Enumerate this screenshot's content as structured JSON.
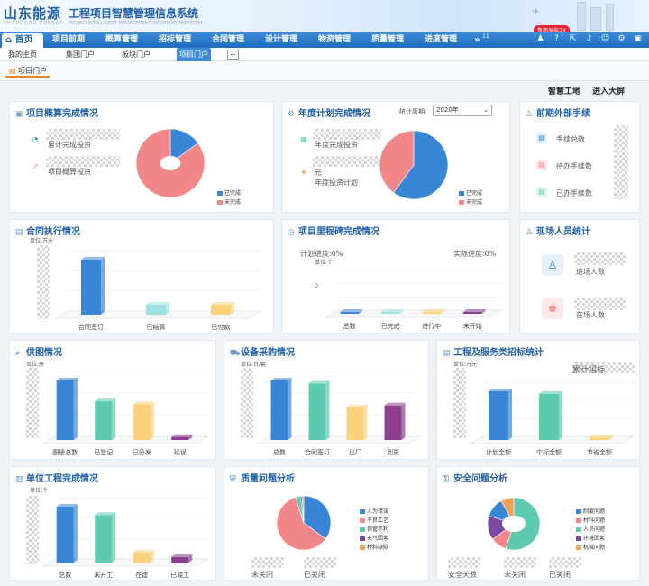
{
  "header": {
    "logo": "山东能源",
    "logo_sub": "SHANDONG ENERGY",
    "title": "工程项目智慧管理信息系统",
    "title_sub": "PROJECTINTELLIGENT MANAGEMENT INFORMATIONSYSTEM",
    "badge": "鲁西发电ZX"
  },
  "nav": {
    "home": "首页",
    "items": [
      "项目前期",
      "概算管理",
      "招标管理",
      "合同管理",
      "设计管理",
      "物资管理",
      "质量管理",
      "进度管理"
    ],
    "more": "»",
    "more_count": "11"
  },
  "tabs": [
    "我的主页",
    "集团门户",
    "板块门户",
    "项目门户"
  ],
  "subtab": "项目门户",
  "actions": {
    "smart_site": "智慧工地",
    "big_screen": "进入大屏"
  },
  "colors": {
    "blue": "#3a86d6",
    "red": "#f2878a",
    "teal": "#5ecbb1",
    "yellow": "#fbd27c",
    "purple": "#8d3e8c",
    "orange": "#f2a35b",
    "brand": "#1f5fa8"
  },
  "cards": {
    "estimate": {
      "title": "项目概算完成情况",
      "icon": "clipboard-icon",
      "rows": [
        "累计完成投资",
        "项目概算投资"
      ],
      "legend": [
        "已完成",
        "未完成"
      ]
    },
    "annual": {
      "title": "年度计划完成情况",
      "icon": "gear-icon",
      "period_label": "统计周期:",
      "period_value": "2020年",
      "rows": [
        "年度完成投资",
        "年度投资计划"
      ],
      "unit": "元",
      "legend": [
        "已完成",
        "未完成"
      ]
    },
    "external": {
      "title": "前期外部手续",
      "icon": "person-icon",
      "rows": [
        "手续总数",
        "待办手续数",
        "已办手续数"
      ]
    },
    "contract": {
      "title": "合同执行情况",
      "icon": "document-icon",
      "unit": "单位:万元"
    },
    "milestone": {
      "title": "项目里程碑完成情况",
      "icon": "clock-icon",
      "plan": "计划进度:0%",
      "actual": "实际进度:0%",
      "unit": "单位:个",
      "y0": "0"
    },
    "staff": {
      "title": "现场人员统计",
      "icon": "person-icon",
      "rows": [
        "进场人数",
        "在场人数"
      ]
    },
    "drawing": {
      "title": "供图情况",
      "icon": "search-icon",
      "unit": "单位:册"
    },
    "equipment": {
      "title": "设备采购情况",
      "icon": "cart-icon",
      "unit": "单位:台/套"
    },
    "bidding": {
      "title": "工程及服务类招标统计",
      "icon": "document-icon",
      "unit": "单位:万元",
      "extra": "累计招标"
    },
    "unit_work": {
      "title": "单位工程完成情况",
      "icon": "tower-icon",
      "unit": "单位:个"
    },
    "quality": {
      "title": "质量问题分析",
      "icon": "shield-icon",
      "stats": [
        "未关闭",
        "已关闭"
      ],
      "legend": [
        "人为错误",
        "不良工艺",
        "保管不利",
        "天气因素",
        "材料缺陷"
      ]
    },
    "safety": {
      "title": "安全问题分析",
      "icon": "lock-icon",
      "stats": [
        "安全天数",
        "未关闭",
        "已关闭"
      ],
      "legend": [
        "制度问题",
        "材料问题",
        "人员问题",
        "环境因素",
        "机械问题"
      ]
    }
  },
  "chart_data": [
    {
      "type": "pie",
      "title": "项目概算完成情况",
      "labels": [
        "已完成",
        "未完成"
      ],
      "values": [
        15,
        85
      ]
    },
    {
      "type": "pie",
      "title": "年度计划完成情况",
      "labels": [
        "已完成",
        "未完成"
      ],
      "values": [
        60,
        40
      ]
    },
    {
      "type": "bar",
      "title": "合同执行情况",
      "categories": [
        "合同签订",
        "已结算",
        "已付款"
      ],
      "values": [
        100,
        18,
        18
      ],
      "ylabel": "单位:万元"
    },
    {
      "type": "bar",
      "title": "项目里程碑完成情况",
      "categories": [
        "总数",
        "已完成",
        "进行中",
        "未开始"
      ],
      "values": [
        0,
        0,
        0,
        0
      ],
      "ylabel": "单位:个"
    },
    {
      "type": "bar",
      "title": "供图情况",
      "categories": [
        "图册总数",
        "已登记",
        "已分发",
        "延误"
      ],
      "values": [
        100,
        65,
        60,
        5
      ],
      "ylabel": "单位:册"
    },
    {
      "type": "bar",
      "title": "设备采购情况",
      "categories": [
        "总数",
        "合同签订",
        "出厂",
        "到货"
      ],
      "values": [
        100,
        95,
        55,
        58
      ],
      "ylabel": "单位:台/套"
    },
    {
      "type": "bar",
      "title": "工程及服务类招标统计",
      "categories": [
        "计划金额",
        "中标金额",
        "节省金额"
      ],
      "values": [
        100,
        95,
        5
      ],
      "ylabel": "单位:万元"
    },
    {
      "type": "bar",
      "title": "单位工程完成情况",
      "categories": [
        "总数",
        "未开工",
        "在建",
        "已竣工"
      ],
      "values": [
        100,
        85,
        18,
        10
      ],
      "ylabel": "单位:个"
    },
    {
      "type": "pie",
      "title": "质量问题分析",
      "labels": [
        "人为错误",
        "不良工艺",
        "保管不利",
        "天气因素",
        "材料缺陷"
      ],
      "values": [
        35,
        60,
        3,
        1,
        1
      ]
    },
    {
      "type": "pie",
      "title": "安全问题分析",
      "labels": [
        "制度问题",
        "材料问题",
        "人员问题",
        "环境因素",
        "机械问题"
      ],
      "values": [
        55,
        10,
        15,
        12,
        8
      ]
    }
  ]
}
